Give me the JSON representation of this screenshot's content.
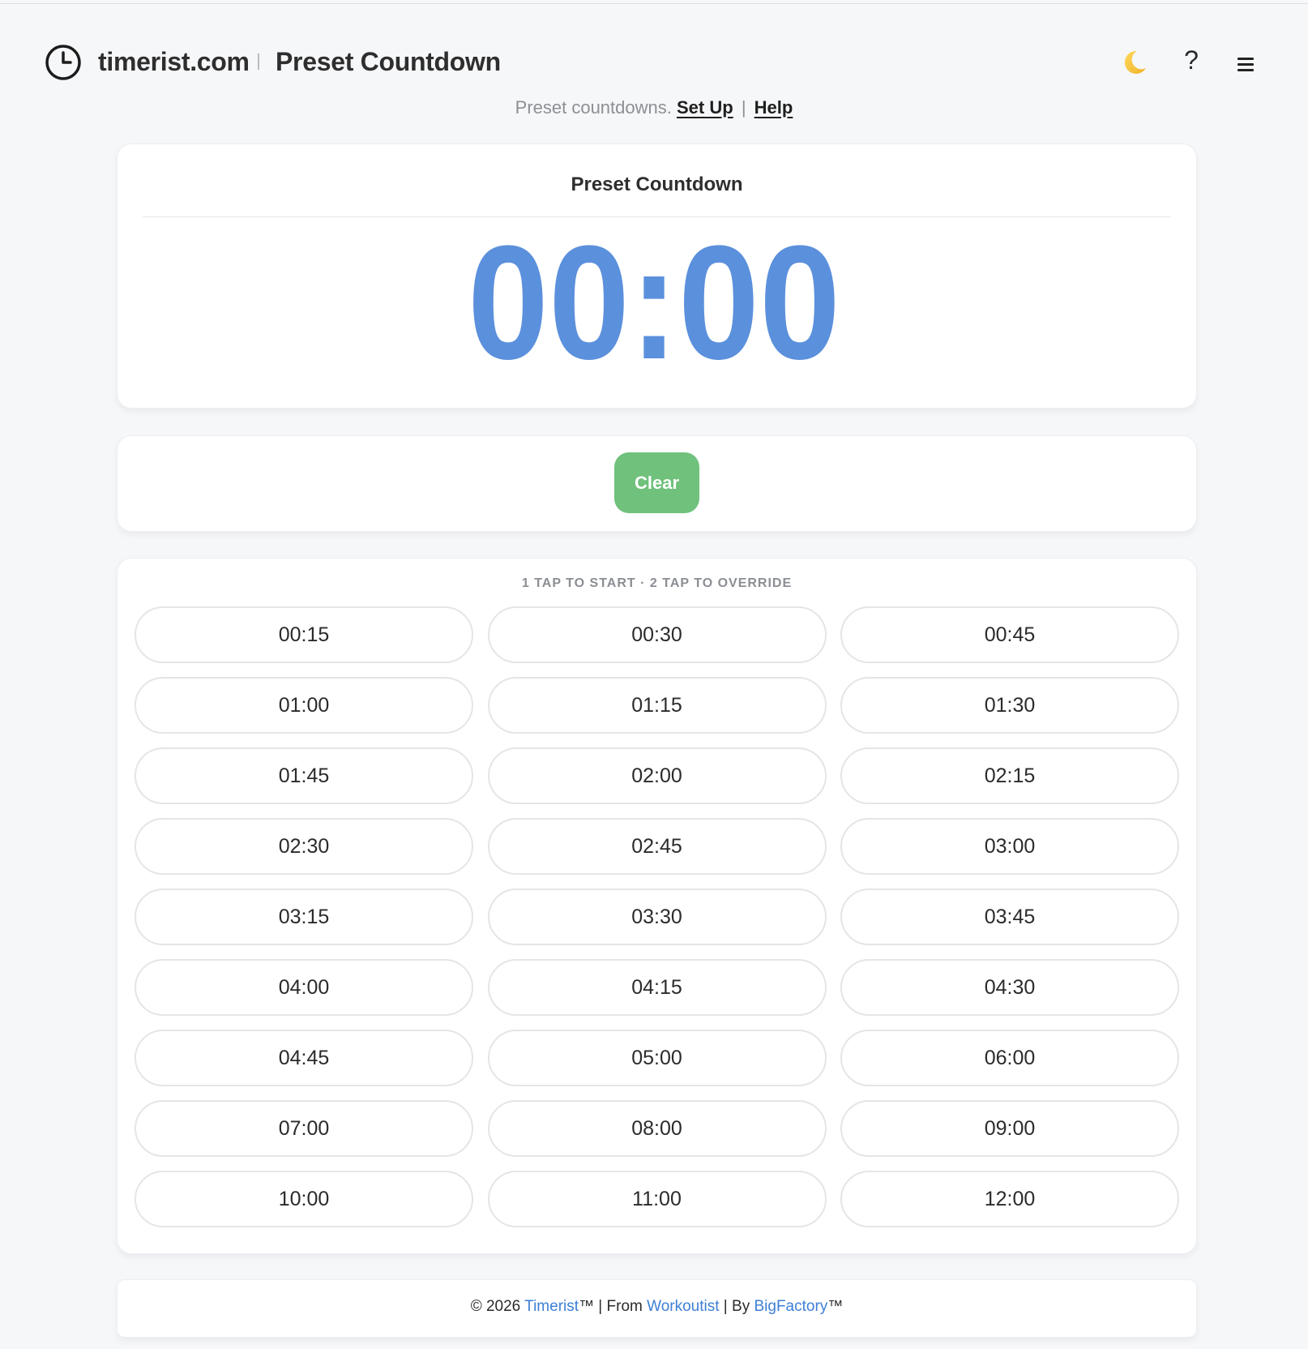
{
  "header": {
    "brand": "timerist.com",
    "title": "Preset Countdown",
    "icons": [
      "clock-icon",
      "moon-icon",
      "help-icon",
      "menu-icon"
    ],
    "help_glyph": "?"
  },
  "subtitle": {
    "text": "Preset countdowns.",
    "setup_link": "Set Up",
    "separator": "|",
    "help_link": "Help"
  },
  "display": {
    "title": "Preset Countdown",
    "time": "00:00",
    "time_color": "#5b90dc"
  },
  "controls": {
    "clear_label": "Clear",
    "clear_color": "#6fc17b"
  },
  "presets": {
    "hint": "1 TAP TO START · 2 TAP TO OVERRIDE",
    "items": [
      "00:15",
      "00:30",
      "00:45",
      "01:00",
      "01:15",
      "01:30",
      "01:45",
      "02:00",
      "02:15",
      "02:30",
      "02:45",
      "03:00",
      "03:15",
      "03:30",
      "03:45",
      "04:00",
      "04:15",
      "04:30",
      "04:45",
      "05:00",
      "06:00",
      "07:00",
      "08:00",
      "09:00",
      "10:00",
      "11:00",
      "12:00"
    ]
  },
  "footer": {
    "copyright": "© 2026 ",
    "timerist_link": "Timerist",
    "tm1": "™ | From ",
    "workoutist_link": "Workoutist",
    "by": " | By ",
    "bigfactory_link": "BigFactory",
    "tm2": "™",
    "link_color": "#3d7fd6"
  }
}
